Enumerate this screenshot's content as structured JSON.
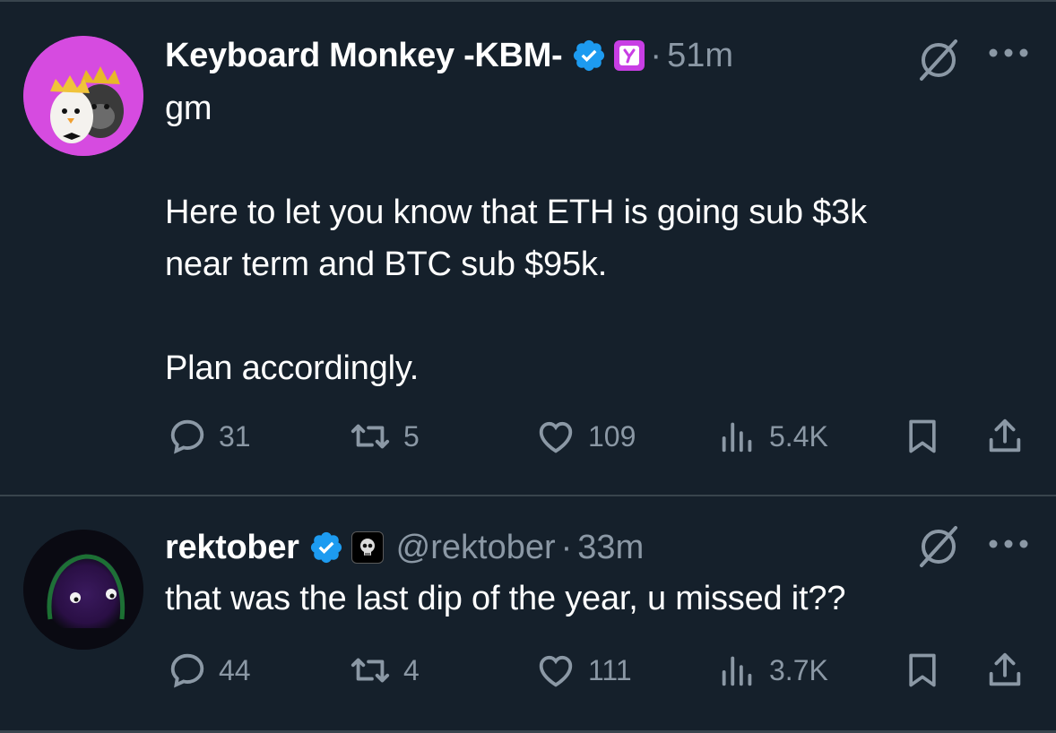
{
  "tweets": [
    {
      "display_name": "Keyboard Monkey -KBM-",
      "handle": "",
      "timestamp": "51m",
      "lines": "gm\n\nHere to let you know that ETH is going sub $3k\nnear term and BTC sub $95k.\n\nPlan accordingly.",
      "replies": "31",
      "reposts": "5",
      "likes": "109",
      "views": "5.4K",
      "avatar_icon": "egg-and-gorilla-avatar",
      "affiliate_icon": "y-logo-badge"
    },
    {
      "display_name": "rektober",
      "handle": "@rektober",
      "timestamp": "33m",
      "lines": "that was the last dip of the year, u missed it??",
      "replies": "44",
      "reposts": "4",
      "likes": "111",
      "views": "3.7K",
      "avatar_icon": "dark-blob-avatar",
      "affiliate_icon": "skull-badge"
    }
  ],
  "separator_dot": "·",
  "colors": {
    "background": "#15202b",
    "text": "#ffffff",
    "muted": "#8b98a5",
    "verified": "#1d9bf0",
    "border": "#38444d"
  }
}
